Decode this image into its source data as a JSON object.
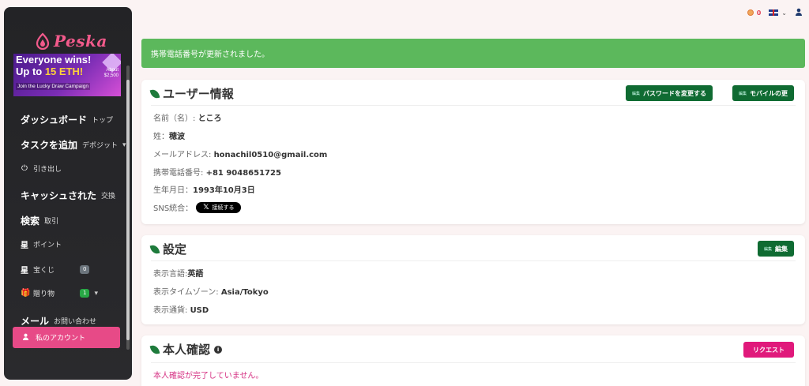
{
  "brand": {
    "name": "Peska"
  },
  "banner": {
    "line1": "Everyone wins!",
    "line2_prefix": "Up to ",
    "line2_highlight": "15 ETH!",
    "side_text_1": "About",
    "side_text_2": "$2,500",
    "line3": "Join the Lucky Draw Campaign"
  },
  "sidebar": {
    "items": [
      {
        "main": "ダッシュボード",
        "sub": "トップ"
      },
      {
        "main": "タスクを追加",
        "sub": "デポジット"
      },
      {
        "main": "",
        "sub": "引き出し"
      },
      {
        "main": "キャッシュされた",
        "sub": "交換"
      },
      {
        "main": "検索",
        "sub": "取引"
      },
      {
        "main": "星",
        "sub": "ポイント"
      },
      {
        "main": "星",
        "sub": "宝くじ",
        "badge": "0"
      },
      {
        "main": "",
        "sub": "贈り物",
        "badge": "1"
      },
      {
        "main": "メール",
        "sub": "お問い合わせ"
      }
    ],
    "account_label": "私のアカウント"
  },
  "topbar": {
    "coin_count": "0"
  },
  "alert": {
    "message": "携帯電話番号が更新されました。"
  },
  "user_info": {
    "title": "ユーザー情報",
    "btn_password_small": "編集",
    "btn_password": "パスワードを変更する",
    "btn_mobile_small": "編集",
    "btn_mobile": "モバイルの更",
    "first_name_label": "名前（名）:",
    "first_name": "ところ",
    "last_name_label": "姓：",
    "last_name": "穂波",
    "email_label": "メールアドレス:",
    "email": "honachil0510@gmail.com",
    "phone_label": "携帯電話番号:",
    "phone": "+81 9048651725",
    "birthday_label": "生年月日：",
    "birthday": "1993年10月3日",
    "sns_label": "SNS統合：",
    "sns_button": "接続する",
    "sns_x": "𝕏"
  },
  "settings": {
    "title": "設定",
    "edit_small": "編集",
    "edit": "編集",
    "language_label": "表示言語:",
    "language": "英語",
    "timezone_label": "表示タイムゾーン:",
    "timezone": "Asia/Tokyo",
    "currency_label": "表示通貨:",
    "currency": "USD"
  },
  "identity": {
    "title": "本人確認",
    "info": "i",
    "request_button": "リクエスト",
    "status": "本人確認が完了していません。"
  },
  "colors": {
    "sidebar_bg": "#232326",
    "brand_pink": "#e74a87",
    "alert_green": "#5cb85c",
    "button_green": "#0f6b32",
    "button_pink": "#e0197b"
  }
}
